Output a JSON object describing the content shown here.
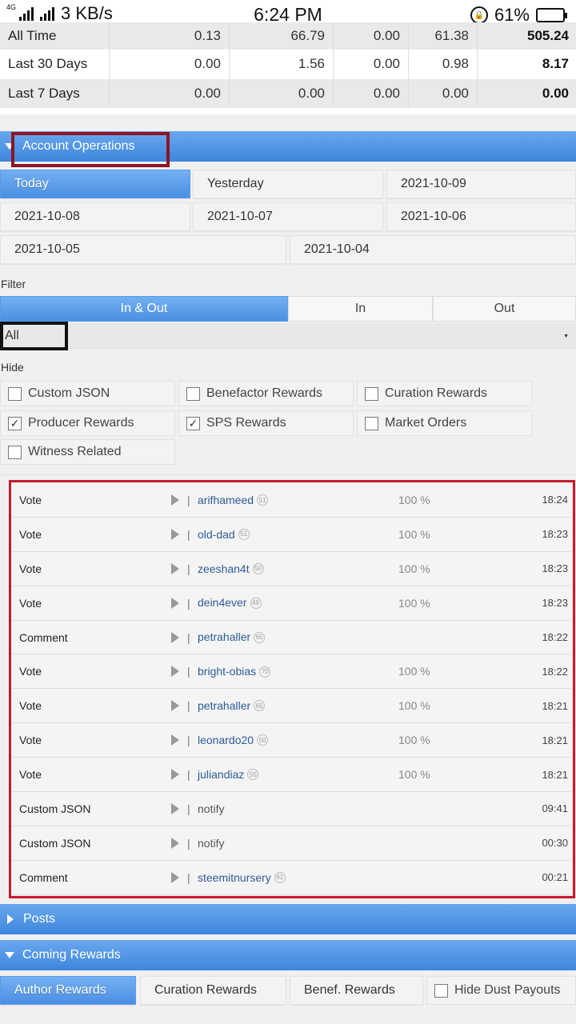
{
  "status_bar": {
    "network": "4G",
    "speed": "3 KB/s",
    "time": "6:24 PM",
    "battery": "61%",
    "battery_level": 0.61
  },
  "stats": {
    "rows": [
      {
        "label": "All Time",
        "v1": "0.13",
        "v2": "66.79",
        "v3": "0.00",
        "v4": "61.38",
        "v5": "505.24"
      },
      {
        "label": "Last 30 Days",
        "v1": "0.00",
        "v2": "1.56",
        "v3": "0.00",
        "v4": "0.98",
        "v5": "8.17"
      },
      {
        "label": "Last 7 Days",
        "v1": "0.00",
        "v2": "0.00",
        "v3": "0.00",
        "v4": "0.00",
        "v5": "0.00"
      }
    ]
  },
  "account_operations": {
    "title": "Account Operations",
    "dates": [
      "Today",
      "Yesterday",
      "2021-10-09",
      "2021-10-08",
      "2021-10-07",
      "2021-10-06",
      "2021-10-05",
      "2021-10-04"
    ],
    "filter_label": "Filter",
    "direction_tabs": [
      "In & Out",
      "In",
      "Out"
    ],
    "select_value": "All",
    "hide_label": "Hide",
    "hide_options": [
      {
        "label": "Custom JSON",
        "checked": false
      },
      {
        "label": "Benefactor Rewards",
        "checked": false
      },
      {
        "label": "Curation Rewards",
        "checked": false
      },
      {
        "label": "Producer Rewards",
        "checked": true
      },
      {
        "label": "SPS Rewards",
        "checked": true
      },
      {
        "label": "Market Orders",
        "checked": false
      },
      {
        "label": "Witness Related",
        "checked": false
      }
    ],
    "operations": [
      {
        "type": "Vote",
        "who": "arifhameed",
        "rep": "51",
        "pct": "100 %",
        "time": "18:24"
      },
      {
        "type": "Vote",
        "who": "old-dad",
        "rep": "51",
        "pct": "100 %",
        "time": "18:23"
      },
      {
        "type": "Vote",
        "who": "zeeshan4t",
        "rep": "50",
        "pct": "100 %",
        "time": "18:23"
      },
      {
        "type": "Vote",
        "who": "dein4ever",
        "rep": "49",
        "pct": "100 %",
        "time": "18:23"
      },
      {
        "type": "Comment",
        "who": "petrahaller",
        "rep": "65",
        "pct": "",
        "time": "18:22"
      },
      {
        "type": "Vote",
        "who": "bright-obias",
        "rep": "70",
        "pct": "100 %",
        "time": "18:22"
      },
      {
        "type": "Vote",
        "who": "petrahaller",
        "rep": "65",
        "pct": "100 %",
        "time": "18:21"
      },
      {
        "type": "Vote",
        "who": "leonardo20",
        "rep": "50",
        "pct": "100 %",
        "time": "18:21"
      },
      {
        "type": "Vote",
        "who": "juliandiaz",
        "rep": "55",
        "pct": "100 %",
        "time": "18:21"
      },
      {
        "type": "Custom JSON",
        "who": "notify",
        "rep": "",
        "pct": "",
        "time": "09:41"
      },
      {
        "type": "Custom JSON",
        "who": "notify",
        "rep": "",
        "pct": "",
        "time": "00:30"
      },
      {
        "type": "Comment",
        "who": "steemitnursery",
        "rep": "61",
        "pct": "",
        "time": "00:21"
      }
    ]
  },
  "posts": {
    "title": "Posts"
  },
  "coming_rewards": {
    "title": "Coming Rewards",
    "tabs": [
      "Author Rewards",
      "Curation Rewards",
      "Benef. Rewards"
    ],
    "hide_dust": "Hide Dust Payouts"
  }
}
